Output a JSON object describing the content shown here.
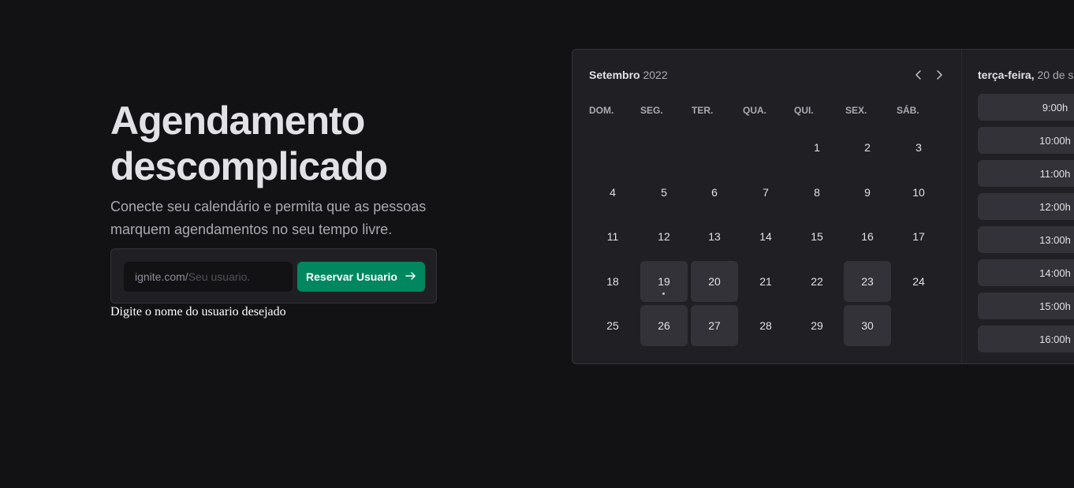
{
  "hero": {
    "title_line1": "Agendamento",
    "title_line2": "descomplicado",
    "subtitle": "Conecte seu calendário e permita que as pessoas marquem agendamentos no seu tempo livre."
  },
  "claim_form": {
    "prefix": "ignite.com/",
    "placeholder": "Seu usuario.",
    "button_label": "Reservar Usuario",
    "hint": "Digite o nome do usuario desejado"
  },
  "calendar": {
    "month": "Setembro",
    "year": "2022",
    "weekdays": [
      "DOM.",
      "SEG.",
      "TER.",
      "QUA.",
      "QUI.",
      "SEX.",
      "SÁB."
    ],
    "weeks": [
      [
        null,
        null,
        null,
        null,
        "1",
        "2",
        "3"
      ],
      [
        "4",
        "5",
        "6",
        "7",
        "8",
        "9",
        "10"
      ],
      [
        "11",
        "12",
        "13",
        "14",
        "15",
        "16",
        "17"
      ],
      [
        "18",
        "19",
        "20",
        "21",
        "22",
        "23",
        "24"
      ],
      [
        "25",
        "26",
        "27",
        "28",
        "29",
        "30",
        null
      ]
    ],
    "available_days": [
      "19",
      "20",
      "23",
      "26",
      "27",
      "30"
    ],
    "today": "19"
  },
  "time_picker": {
    "weekday": "terça-feira,",
    "date": "20 de s",
    "slots": [
      "9:00h",
      "10:00h",
      "11:00h",
      "12:00h",
      "13:00h",
      "14:00h",
      "15:00h",
      "16:00h"
    ]
  },
  "colors": {
    "background": "#121214",
    "panel": "#202024",
    "accent": "#00875f"
  },
  "icons": {
    "prev": "chevron-left-icon",
    "next": "chevron-right-icon",
    "arrow": "arrow-right-icon"
  }
}
